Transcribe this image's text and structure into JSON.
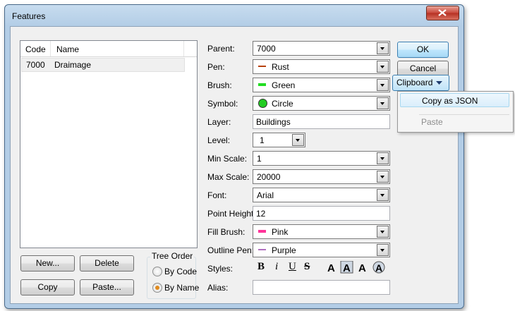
{
  "window": {
    "title": "Features"
  },
  "list": {
    "columns": [
      "Code",
      "Name"
    ],
    "rows": [
      {
        "code": "7000",
        "name": "Draimage"
      }
    ]
  },
  "buttons": {
    "new": "New...",
    "delete": "Delete",
    "copy": "Copy",
    "paste": "Paste...",
    "ok": "OK",
    "cancel": "Cancel",
    "clipboard": "Clipboard"
  },
  "tree_order": {
    "title": "Tree Order",
    "by_code": "By Code",
    "by_name": "By Name",
    "selected": "By Name"
  },
  "fields": {
    "parent": {
      "label": "Parent:",
      "value": "7000"
    },
    "pen": {
      "label": "Pen:",
      "value": "Rust",
      "color": "#b7410e"
    },
    "brush": {
      "label": "Brush:",
      "value": "Green",
      "color": "#22dd22"
    },
    "symbol": {
      "label": "Symbol:",
      "value": "Circle",
      "color": "#22cc22"
    },
    "layer": {
      "label": "Layer:",
      "value": "Buildings"
    },
    "level": {
      "label": "Level:",
      "value": "1"
    },
    "min_scale": {
      "label": "Min Scale:",
      "value": "1"
    },
    "max_scale": {
      "label": "Max Scale:",
      "value": "20000"
    },
    "font": {
      "label": "Font:",
      "value": "Arial"
    },
    "point_height": {
      "label": "Point Height:",
      "value": "12"
    },
    "fill_brush": {
      "label": "Fill Brush:",
      "value": "Pink",
      "color": "#ff3399"
    },
    "outline_pen": {
      "label": "Outline Pen:",
      "value": "Purple",
      "color": "#b070c0"
    },
    "styles": {
      "label": "Styles:"
    },
    "alias": {
      "label": "Alias:",
      "value": ""
    }
  },
  "style_buttons": {
    "bold": "B",
    "italic": "i",
    "underline": "U",
    "strike": "S"
  },
  "clipboard_menu": {
    "items": [
      "Copy as JSON",
      "Paste"
    ]
  }
}
